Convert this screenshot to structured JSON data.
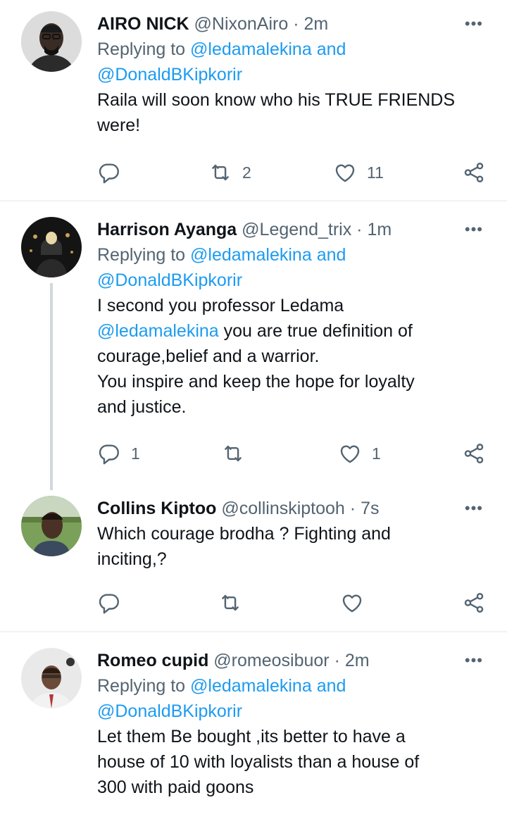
{
  "tweets": [
    {
      "name": "AIRO NICK",
      "handle": "@NixonAiro",
      "dot": "·",
      "time": "2m",
      "replying_prefix": "Replying to",
      "replying_1": "@ledamalekina",
      "replying_and": "and",
      "replying_2": "@DonaldBKipkorir",
      "text_lines": [
        "Raila will soon know who his TRUE FRIENDS",
        "were!"
      ],
      "retweets": "2",
      "likes": "11"
    },
    {
      "name": "Harrison Ayanga",
      "handle": "@Legend_trix",
      "dot": "·",
      "time": "1m",
      "replying_prefix": "Replying to",
      "replying_1": "@ledamalekina",
      "replying_and": "and",
      "replying_2": "@DonaldBKipkorir",
      "line1": "I second you professor Ledama",
      "mention": "@ledamalekina",
      "line2_rest": " you are true definition of",
      "line3": "courage,belief and a warrior.",
      "line4": "You inspire and keep the hope for loyalty",
      "line5": "and justice.",
      "replies": "1",
      "likes": "1"
    },
    {
      "name": "Collins Kiptoo",
      "handle": "@collinskiptooh",
      "dot": "·",
      "time": "7s",
      "text_lines": [
        "Which courage brodha ? Fighting and",
        "inciting,?"
      ]
    },
    {
      "name": "Romeo cupid",
      "handle": "@romeosibuor",
      "dot": "·",
      "time": "2m",
      "replying_prefix": "Replying to",
      "replying_1": "@ledamalekina",
      "replying_and": "and",
      "replying_2": "@DonaldBKipkorir",
      "text_lines": [
        "Let them Be bought ,its better to have a",
        "house of 10 with loyalists than a house of",
        "300 with paid goons"
      ]
    }
  ],
  "more_glyph": "•••",
  "colors": {
    "mention": "#1d9bf0",
    "secondary": "#536471",
    "divider": "#eff3f4",
    "thread": "#cfd9de"
  }
}
